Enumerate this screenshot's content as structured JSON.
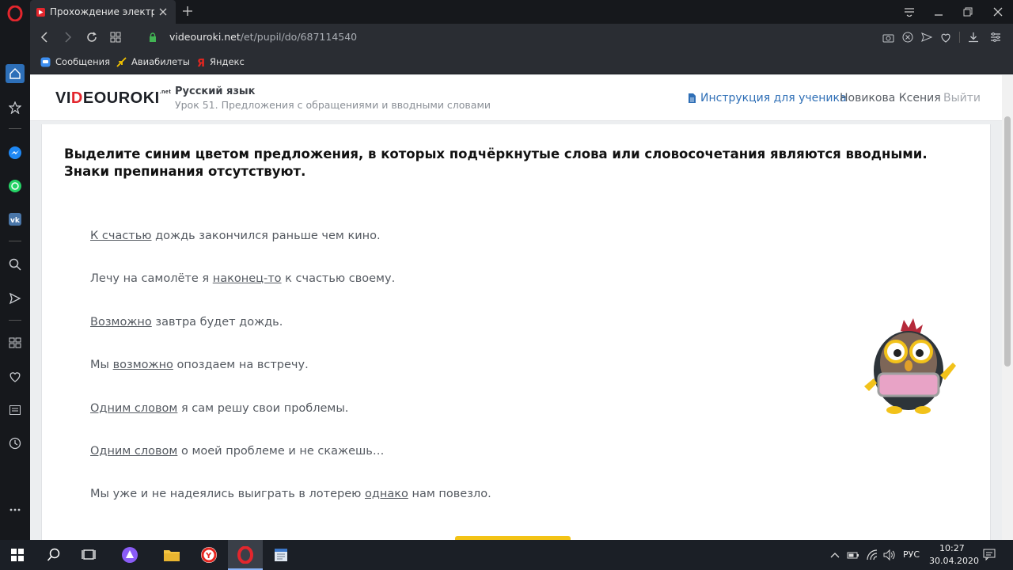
{
  "browser": {
    "tab_title": "Прохождение электронно",
    "url_host": "videouroki.net",
    "url_path": "/et/pupil/do/687114540",
    "bookmarks": [
      {
        "label": "Сообщения",
        "icon": "messages-icon"
      },
      {
        "label": "Авиабилеты",
        "icon": "airplane-icon"
      },
      {
        "label": "Яндекс",
        "icon": "yandex-icon"
      }
    ]
  },
  "site": {
    "logo_left": "VI",
    "logo_accent": "D",
    "logo_right": "EOUROKI",
    "logo_tld": ".net",
    "subject": "Русский язык",
    "lesson": "Урок 51. Предложения с обращениями и вводными словами",
    "instruction_link": "Инструкция для ученика",
    "username": "Новикова Ксения",
    "logout": "Выйти"
  },
  "task": {
    "question": "Выделите синим цветом предложения, в которых подчёркнутые слова или словосочетания являются вводными. Знаки препинания отсутствуют.",
    "sentences": [
      {
        "pre": "",
        "underlined": "К счастью",
        "post": " дождь закончился раньше чем кино."
      },
      {
        "pre": "Лечу на самолёте я ",
        "underlined": "наконец-то",
        "post": " к счастью своему."
      },
      {
        "pre": "",
        "underlined": "Возможно",
        "post": " завтра будет дождь."
      },
      {
        "pre": "Мы ",
        "underlined": "возможно",
        "post": " опоздаем на встречу."
      },
      {
        "pre": "",
        "underlined": "Одним словом",
        "post": " я сам решу свои проблемы."
      },
      {
        "pre": "",
        "underlined": "Одним словом",
        "post": " о моей проблеме и не скажешь…"
      },
      {
        "pre": "Мы уже и не надеялись выиграть в лотерею ",
        "underlined": "однако",
        "post": " нам повезло."
      }
    ]
  },
  "taskbar": {
    "language": "РУС",
    "time": "10:27",
    "date": "30.04.2020"
  },
  "colors": {
    "accent_blue": "#2f6fb6",
    "logo_red": "#e3262d",
    "button_yellow": "#f3c316"
  }
}
